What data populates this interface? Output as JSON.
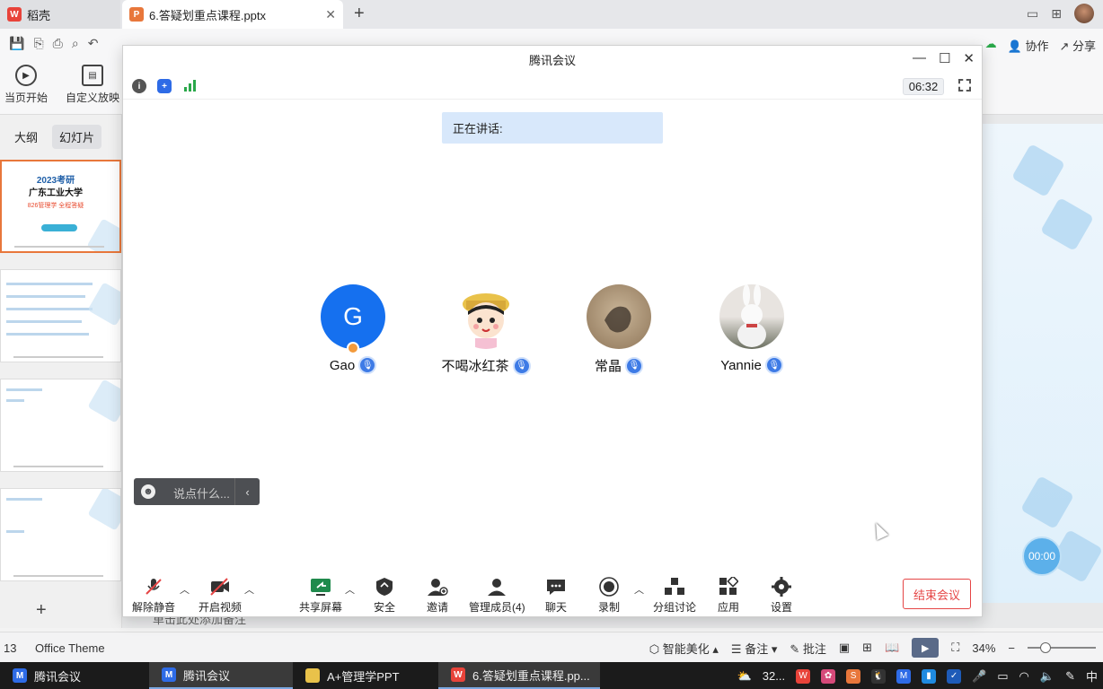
{
  "wps": {
    "tabs": [
      {
        "label": "稻壳",
        "icon": "wps-docer-icon"
      },
      {
        "label": "6.答疑划重点课程.pptx",
        "icon": "ppt-file-icon"
      }
    ],
    "menu_right": {
      "collab": "协作",
      "share": "分享"
    },
    "ribbon": {
      "from_current": "当页开始",
      "custom_show": "自定义放映"
    },
    "panel_tabs": {
      "outline": "大纲",
      "slides": "幻灯片"
    },
    "thumb1": {
      "title": "2023考研",
      "subtitle": "广东工业大学",
      "red": "826管理学 全程答疑"
    },
    "notes_hint": "单击此处添加备注",
    "timer_bubble": "00:00",
    "status": {
      "slide_num": "13",
      "theme": "Office Theme",
      "beautify": "智能美化",
      "notes": "备注",
      "comments": "批注",
      "zoom": "34%"
    }
  },
  "meeting": {
    "title": "腾讯会议",
    "elapsed": "06:32",
    "speaking_label": "正在讲话:",
    "participants": [
      {
        "name": "Gao",
        "initial": "G"
      },
      {
        "name": "不喝冰红茶"
      },
      {
        "name": "常晶"
      },
      {
        "name": "Yannie"
      }
    ],
    "chat_placeholder": "说点什么...",
    "toolbar": {
      "unmute": "解除静音",
      "start_video": "开启视频",
      "share_screen": "共享屏幕",
      "security": "安全",
      "invite": "邀请",
      "manage_members": "管理成员(4)",
      "chat": "聊天",
      "record": "录制",
      "breakout": "分组讨论",
      "apps": "应用",
      "settings": "设置",
      "end_meeting": "结束会议"
    },
    "colors": {
      "accent": "#1570ef",
      "end": "#e54545",
      "speaking_bg": "#d8e8fb"
    }
  },
  "taskbar": {
    "items": [
      {
        "label": "腾讯会议"
      },
      {
        "label": "腾讯会议"
      },
      {
        "label": "A+管理学PPT"
      },
      {
        "label": "6.答疑划重点课程.pp..."
      }
    ],
    "weather": "32...",
    "ime": "中"
  }
}
